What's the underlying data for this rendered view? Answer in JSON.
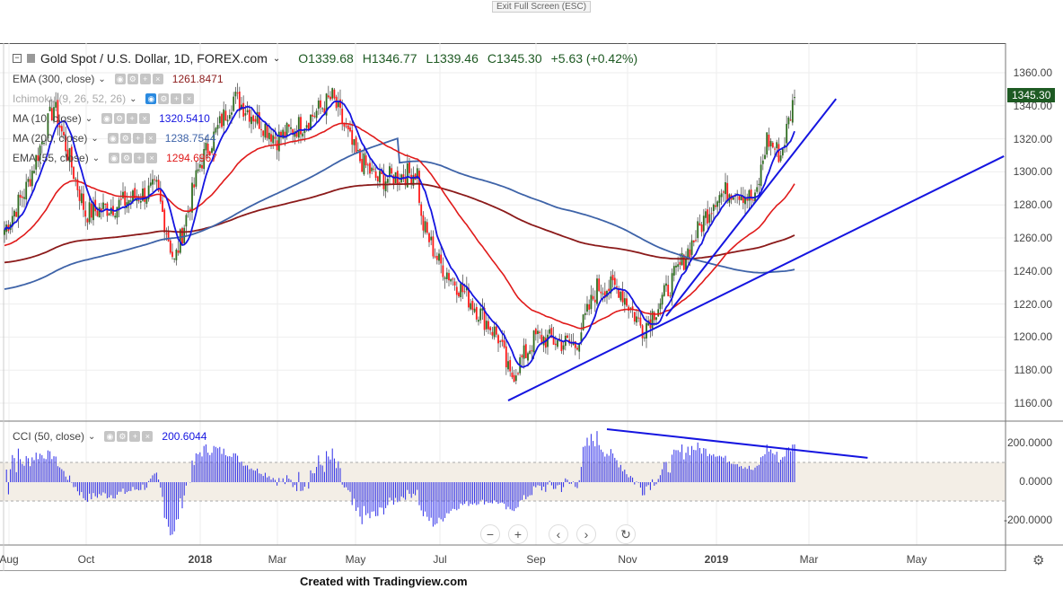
{
  "window": {
    "exit_fullscreen": "Exit Full Screen (ESC)",
    "footer": "Created with Tradingview.com"
  },
  "header": {
    "symbol": "Gold Spot / U.S. Dollar, 1D, FOREX.com",
    "open": "O1339.68",
    "high": "H1346.77",
    "low": "L1339.46",
    "close": "C1345.30",
    "change": "+5.63 (+0.42%)"
  },
  "indicators": [
    {
      "label": "EMA (300, close)",
      "value": "1261.8471",
      "color": "#8b1a1a"
    },
    {
      "label": "Ichimoku (9, 26, 52, 26)",
      "value": "",
      "color": "#999999"
    },
    {
      "label": "MA (10, close)",
      "value": "1320.5410",
      "color": "#1515e0"
    },
    {
      "label": "MA (200, close)",
      "value": "1238.7544",
      "color": "#3e63a8"
    },
    {
      "label": "EMA (55, close)",
      "value": "1294.6967",
      "color": "#e01a1a"
    }
  ],
  "cci": {
    "label": "CCI (50, close)",
    "value": "200.6044",
    "ticks": [
      "200.0000",
      "0.0000",
      "-200.0000"
    ]
  },
  "price_axis": {
    "ticks": [
      "1360.00",
      "1340.00",
      "1320.00",
      "1300.00",
      "1280.00",
      "1260.00",
      "1240.00",
      "1220.00",
      "1200.00",
      "1180.00",
      "1160.00"
    ],
    "last": "1345.30"
  },
  "time_axis": [
    "Aug",
    "Oct",
    "2018",
    "Mar",
    "May",
    "Jul",
    "Sep",
    "Nov",
    "2019",
    "Mar",
    "May"
  ],
  "nav": {
    "zoom_out": "−",
    "zoom_in": "+",
    "back": "‹",
    "forward": "›",
    "reset": "↻"
  },
  "colors": {
    "up": "#2d6b1f",
    "down": "#ff1a1a",
    "ma10": "#1515e0",
    "ema55": "#e01a1a",
    "ma200": "#3e63a8",
    "ema300": "#8b1a1a",
    "trend": "#1515e0"
  },
  "chart_data": {
    "type": "candlestick",
    "bars": 401,
    "price_anchors": [
      [
        0,
        1265
      ],
      [
        11,
        1290
      ],
      [
        25,
        1340
      ],
      [
        41,
        1275
      ],
      [
        57,
        1280
      ],
      [
        77,
        1290
      ],
      [
        86,
        1245
      ],
      [
        99,
        1305
      ],
      [
        116,
        1345
      ],
      [
        130,
        1330
      ],
      [
        138,
        1320
      ],
      [
        152,
        1330
      ],
      [
        166,
        1345
      ],
      [
        178,
        1310
      ],
      [
        189,
        1295
      ],
      [
        209,
        1300
      ],
      [
        211,
        1270
      ],
      [
        220,
        1245
      ],
      [
        234,
        1225
      ],
      [
        250,
        1200
      ],
      [
        256,
        1175
      ],
      [
        269,
        1200
      ],
      [
        289,
        1195
      ],
      [
        300,
        1230
      ],
      [
        311,
        1230
      ],
      [
        323,
        1205
      ],
      [
        334,
        1225
      ],
      [
        343,
        1245
      ],
      [
        360,
        1285
      ],
      [
        370,
        1290
      ],
      [
        380,
        1282
      ],
      [
        386,
        1320
      ],
      [
        393,
        1310
      ],
      [
        400,
        1345.3
      ]
    ],
    "trendlines": [
      [
        [
          255,
          1161.6
        ],
        [
          506,
          1309.5
        ]
      ],
      [
        [
          335,
          1212.7
        ],
        [
          421,
          1344.2
        ]
      ]
    ],
    "cci_trendline": [
      [
        305,
        281
      ],
      [
        437,
        129
      ]
    ],
    "ylim": [
      1150,
      1375
    ],
    "cci_ylim": [
      -330,
      300
    ]
  }
}
